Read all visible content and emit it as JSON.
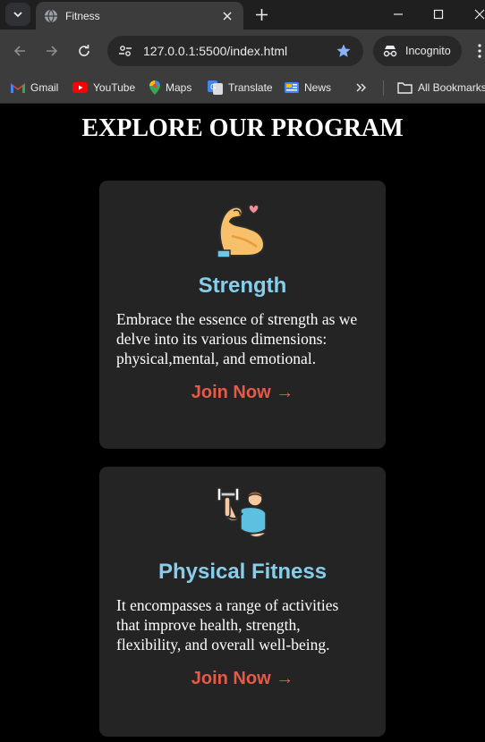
{
  "browser": {
    "tab": {
      "title": "Fitness"
    },
    "address": {
      "url": "127.0.0.1:5500/index.html"
    },
    "profile": {
      "label": "Incognito"
    },
    "bookmarks": [
      {
        "label": "Gmail",
        "icon": "gmail-icon"
      },
      {
        "label": "YouTube",
        "icon": "youtube-icon"
      },
      {
        "label": "Maps",
        "icon": "maps-icon"
      },
      {
        "label": "Translate",
        "icon": "translate-icon"
      },
      {
        "label": "News",
        "icon": "news-icon"
      }
    ],
    "all_bookmarks_label": "All Bookmarks"
  },
  "page": {
    "title": "EXPLORE OUR PROGRAM",
    "cards": [
      {
        "icon": "flexed-arm-heart-icon",
        "title": "Strength",
        "description_lines": [
          "Embrace the essence of strength as we",
          "delve into its various dimensions:",
          "physical,mental, and emotional."
        ],
        "cta": "Join Now →"
      },
      {
        "icon": "dumbbell-lifter-icon",
        "title": "Physical Fitness",
        "description_lines": [
          "It encompasses a range of activities",
          "that improve health, strength,",
          "flexibility, and overall well-being."
        ],
        "cta": "Join Now →"
      }
    ]
  },
  "colors": {
    "page_background": "#000000",
    "card_background": "#242424",
    "card_title": "#87ceeb",
    "cta": "#e65a47"
  }
}
